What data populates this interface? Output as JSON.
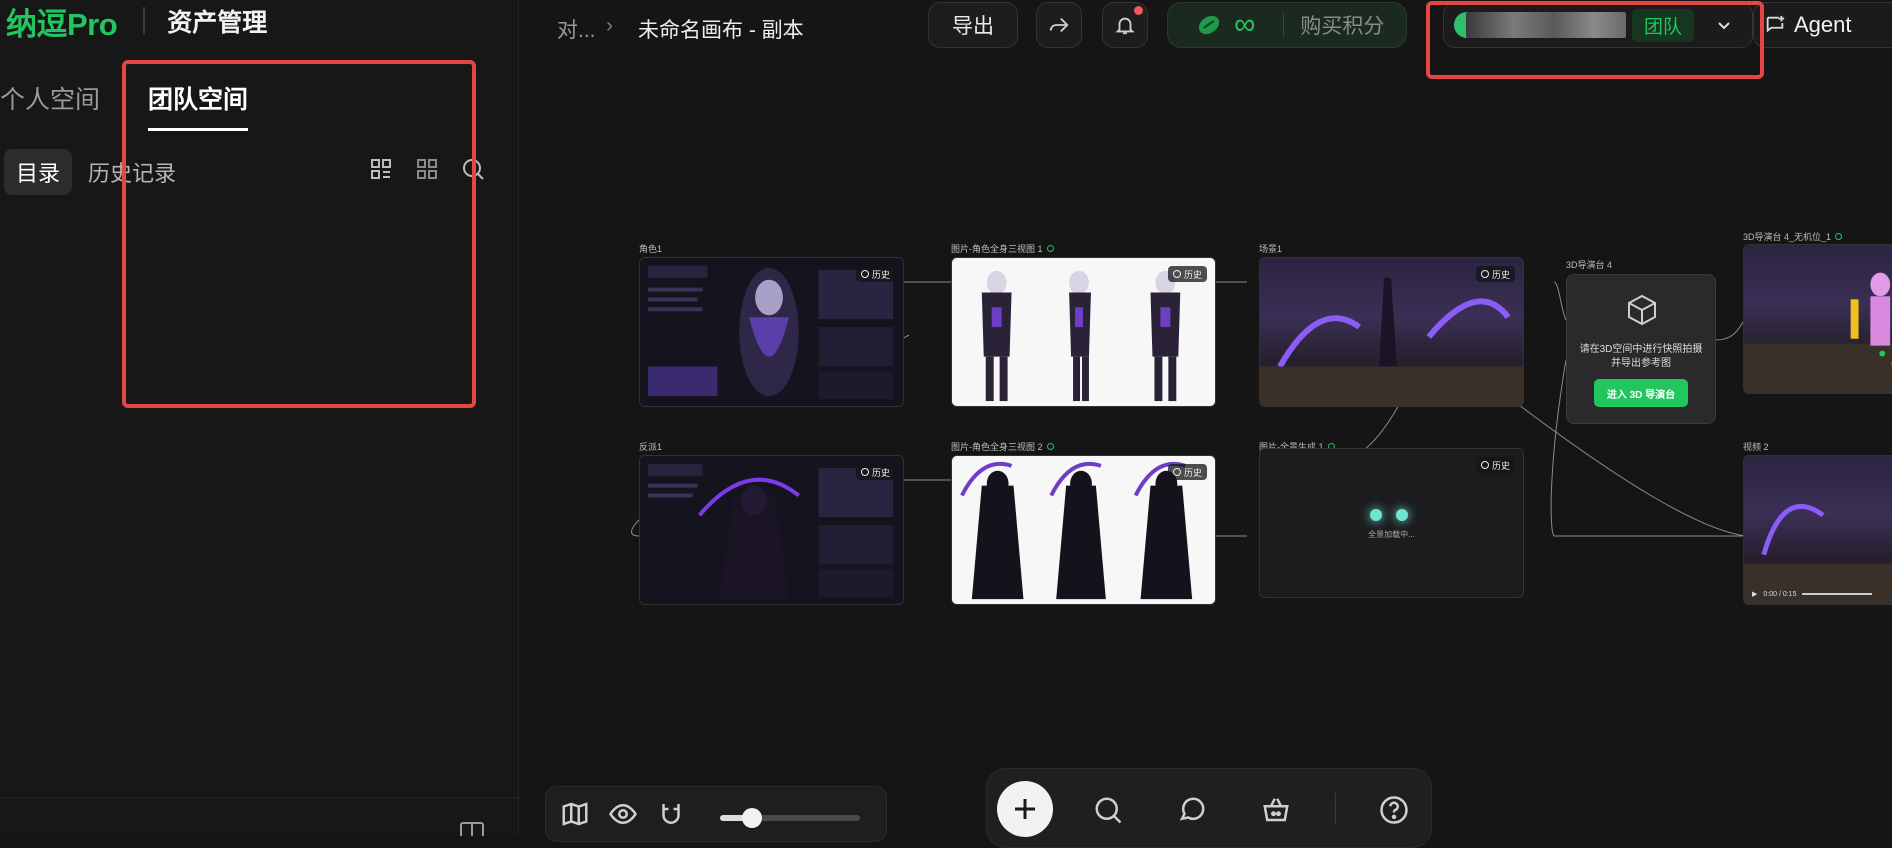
{
  "brand": {
    "logo": "纳逗Pro",
    "title": "资产管理"
  },
  "space_tabs": [
    {
      "label": "个人空间",
      "active": false
    },
    {
      "label": "团队空间",
      "active": true
    }
  ],
  "sub_tabs": [
    {
      "label": "目录",
      "active": true
    },
    {
      "label": "历史记录",
      "active": false
    }
  ],
  "sidebar_tools": [
    "grid-view-icon",
    "small-grid-icon",
    "search-icon"
  ],
  "topbar": {
    "breadcrumb": "对...",
    "title": "未命名画布 - 副本",
    "export_label": "导出",
    "credits_symbol": "∞",
    "buy_label": "购买积分",
    "team_badge": "团队",
    "agent_label": "Agent"
  },
  "canvas": {
    "history_label": "历史",
    "nodes": {
      "role1": "角色1",
      "img1": "图片-角色全身三视图 1",
      "scene1": "场景1",
      "stage4": "3D导演台 4",
      "stage4_out": "3D导演台 4_无机位_1",
      "villain1": "反派1",
      "img2": "图片-角色全身三视图 2",
      "panorama1": "图片-全景生成 1",
      "video2": "视频 2"
    },
    "stage_card": {
      "text_line1": "请在3D空间中进行快照拍摄",
      "text_line2": "并导出参考图",
      "button": "进入 3D 导演台"
    },
    "generating_text": "全景加载中...",
    "video_time": "0:00 / 0:15"
  },
  "zoom": {
    "level": 0.18
  },
  "colors": {
    "accent": "#22c55e",
    "highlight": "#e64545",
    "notify": "#ef5a5a"
  }
}
